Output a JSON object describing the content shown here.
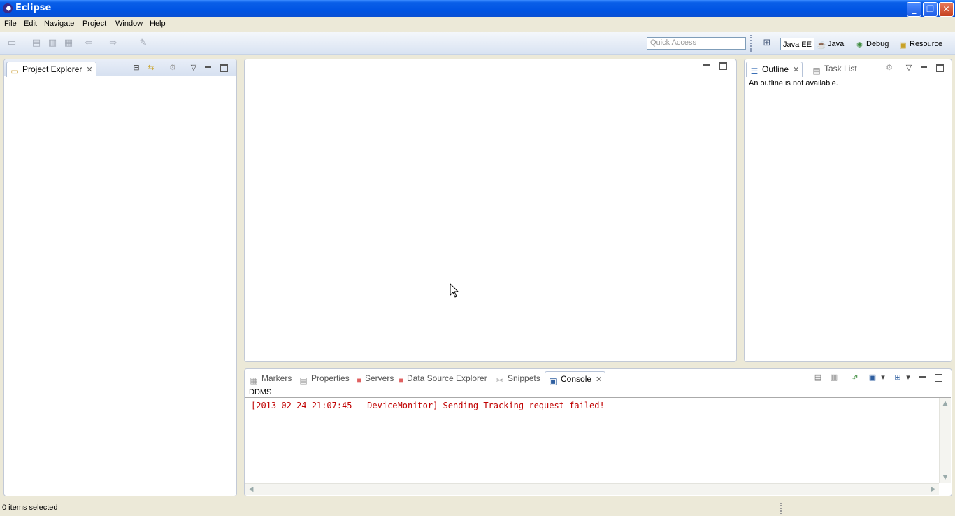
{
  "window": {
    "title": "Eclipse"
  },
  "menu": [
    "File",
    "Edit",
    "Navigate",
    "Project",
    "Window",
    "Help"
  ],
  "toolbar": {
    "quick_access_placeholder": "Quick Access",
    "perspectives": [
      {
        "label": "Java EE",
        "icon": "java-ee-icon",
        "active": true
      },
      {
        "label": "Java",
        "icon": "java-icon",
        "active": false
      },
      {
        "label": "Debug",
        "icon": "debug-icon",
        "active": false
      },
      {
        "label": "Resource",
        "icon": "resource-icon",
        "active": false
      }
    ]
  },
  "project_explorer": {
    "tab_label": "Project Explorer"
  },
  "outline": {
    "tabs": [
      {
        "label": "Outline",
        "active": true
      },
      {
        "label": "Task List",
        "active": false
      }
    ],
    "message": "An outline is not available."
  },
  "bottom": {
    "tabs": [
      {
        "label": "Markers",
        "active": false
      },
      {
        "label": "Properties",
        "active": false
      },
      {
        "label": "Servers",
        "active": false
      },
      {
        "label": "Data Source Explorer",
        "active": false
      },
      {
        "label": "Snippets",
        "active": false
      },
      {
        "label": "Console",
        "active": true
      }
    ],
    "console_name": "DDMS",
    "console_line": "[2013-02-24 21:07:45 - DeviceMonitor] Sending Tracking request failed!"
  },
  "status": {
    "text": "0 items selected"
  },
  "colors": {
    "console_error": "#c00000",
    "titlebar": "#0054e3"
  }
}
